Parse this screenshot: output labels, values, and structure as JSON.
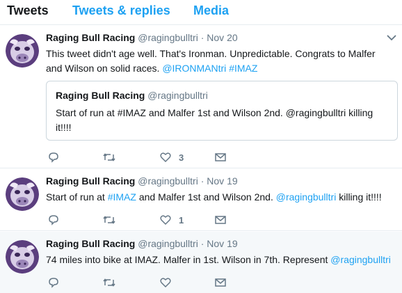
{
  "tabs": [
    {
      "label": "Tweets",
      "active": true
    },
    {
      "label": "Tweets & replies",
      "active": false
    },
    {
      "label": "Media",
      "active": false
    }
  ],
  "tweets": [
    {
      "name": "Raging Bull Racing",
      "handle": "@ragingbulltri",
      "dot": "·",
      "date": "Nov 20",
      "text_plain": "This tweet didn't age well. That's Ironman. Unpredictable. Congrats to Malfer and Wilson on solid races.",
      "link1": "@IRONMANtri",
      "link2": "#IMAZ",
      "quote": {
        "name": "Raging Bull Racing",
        "handle": "@ragingbulltri",
        "text": "Start of run at #IMAZ and Malfer 1st and Wilson 2nd. @ragingbulltri killing it!!!!"
      },
      "likes": "3"
    },
    {
      "name": "Raging Bull Racing",
      "handle": "@ragingbulltri",
      "dot": "·",
      "date": "Nov 19",
      "text_a": "Start of run at ",
      "link1": "#IMAZ",
      "text_b": " and Malfer 1st and Wilson 2nd. ",
      "link2": "@ragingbulltri",
      "text_c": " killing it!!!!",
      "likes": "1"
    },
    {
      "name": "Raging Bull Racing",
      "handle": "@ragingbulltri",
      "dot": "·",
      "date": "Nov 19",
      "text_a": "74 miles into bike at IMAZ. Malfer in 1st. Wilson in 7th. Represent ",
      "link1": "@ragingbulltri"
    }
  ],
  "colors": {
    "link": "#1da1f2",
    "muted": "#657786",
    "border": "#e6ecf0",
    "tint": "#f5f8fa"
  },
  "icons": [
    "reply-icon",
    "retweet-icon",
    "like-icon",
    "direct-message-icon",
    "caret-down-icon"
  ]
}
